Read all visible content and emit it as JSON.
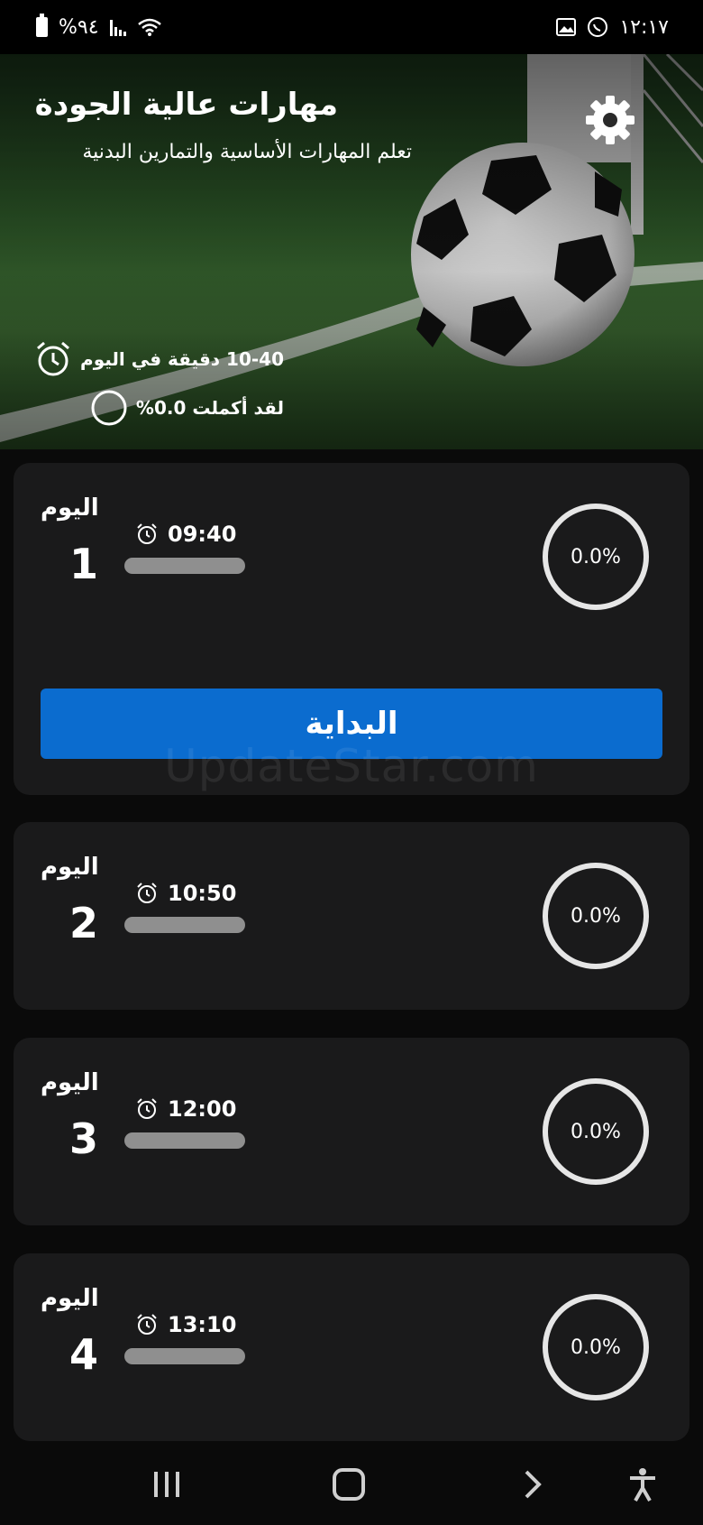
{
  "status_bar": {
    "battery": "%٩٤",
    "time": "١٢:١٧"
  },
  "header": {
    "title": "مهارات عالية الجودة",
    "subtitle": "تعلم المهارات الأساسية والتمارين البدنية",
    "duration": "10-40 دقيقة في اليوم",
    "completion": "لقد أكملت 0.0%"
  },
  "days": [
    {
      "label": "اليوم",
      "number": "1",
      "time": "09:40",
      "progress": "0.0%",
      "start_label": "البداية"
    },
    {
      "label": "اليوم",
      "number": "2",
      "time": "10:50",
      "progress": "0.0%"
    },
    {
      "label": "اليوم",
      "number": "3",
      "time": "12:00",
      "progress": "0.0%"
    },
    {
      "label": "اليوم",
      "number": "4",
      "time": "13:10",
      "progress": "0.0%"
    }
  ],
  "watermark": "UpdateStar.com",
  "colors": {
    "accent": "#0b6ccf",
    "card": "#1a1a1b",
    "background": "#0a0a0a"
  },
  "icons": [
    "settings-gear-icon",
    "alarm-clock-icon",
    "circle-icon",
    "recents-icon",
    "home-icon",
    "back-icon",
    "accessibility-icon"
  ]
}
